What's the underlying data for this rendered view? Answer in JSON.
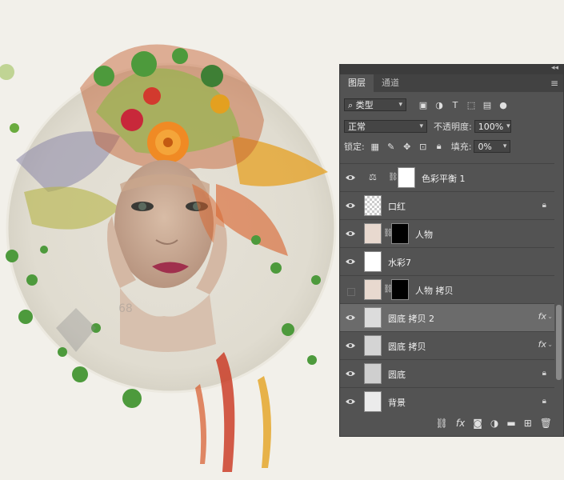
{
  "panel": {
    "tabs": [
      {
        "label": "图层",
        "active": true
      },
      {
        "label": "通道",
        "active": false
      }
    ],
    "filter": {
      "label": "类型"
    },
    "blend_mode": "正常",
    "opacity_label": "不透明度:",
    "opacity_value": "100%",
    "lock_label": "锁定:",
    "fill_label": "填充:",
    "fill_value": "0%",
    "layers": [
      {
        "name": "色彩平衡 1",
        "visible": true,
        "type": "adjustment"
      },
      {
        "name": "口红",
        "visible": true,
        "locked": true
      },
      {
        "name": "人物",
        "visible": true,
        "mask": true
      },
      {
        "name": "水彩7",
        "visible": true
      },
      {
        "name": "人物 拷贝",
        "visible": false,
        "mask": true
      },
      {
        "name": "圆底 拷贝 2",
        "visible": true,
        "fx": "fx",
        "selected": true
      },
      {
        "name": "圆底 拷贝",
        "visible": true,
        "fx": "fx"
      },
      {
        "name": "圆底",
        "visible": true,
        "locked": true
      },
      {
        "name": "背景",
        "visible": true,
        "locked": true
      }
    ],
    "bottom_icons": [
      "link-icon",
      "fx-icon",
      "mask-icon",
      "adjustment-icon",
      "folder-icon",
      "new-layer-icon",
      "trash-icon"
    ]
  },
  "canvas": {
    "watermark_text": "68"
  }
}
